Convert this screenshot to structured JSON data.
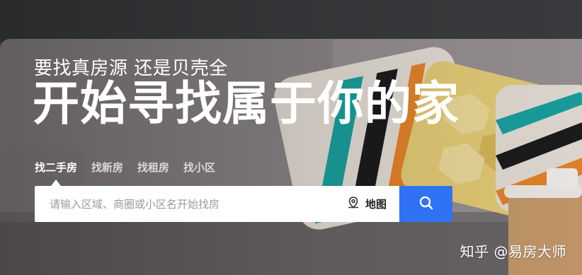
{
  "hero": {
    "subtitle": "要找真房源 还是贝壳全",
    "title": "开始寻找属于你的家"
  },
  "tabs": [
    {
      "label": "找二手房",
      "active": true
    },
    {
      "label": "找新房",
      "active": false
    },
    {
      "label": "找租房",
      "active": false
    },
    {
      "label": "找小区",
      "active": false
    }
  ],
  "search": {
    "placeholder": "请输入区域、商圈或小区名开始找房",
    "value": "",
    "map_label": "地图",
    "map_icon": "map-pin-icon",
    "button_icon": "search-icon"
  },
  "watermark": "知乎 @易房大师",
  "colors": {
    "accent": "#3072f6",
    "text": "#ffffff"
  }
}
